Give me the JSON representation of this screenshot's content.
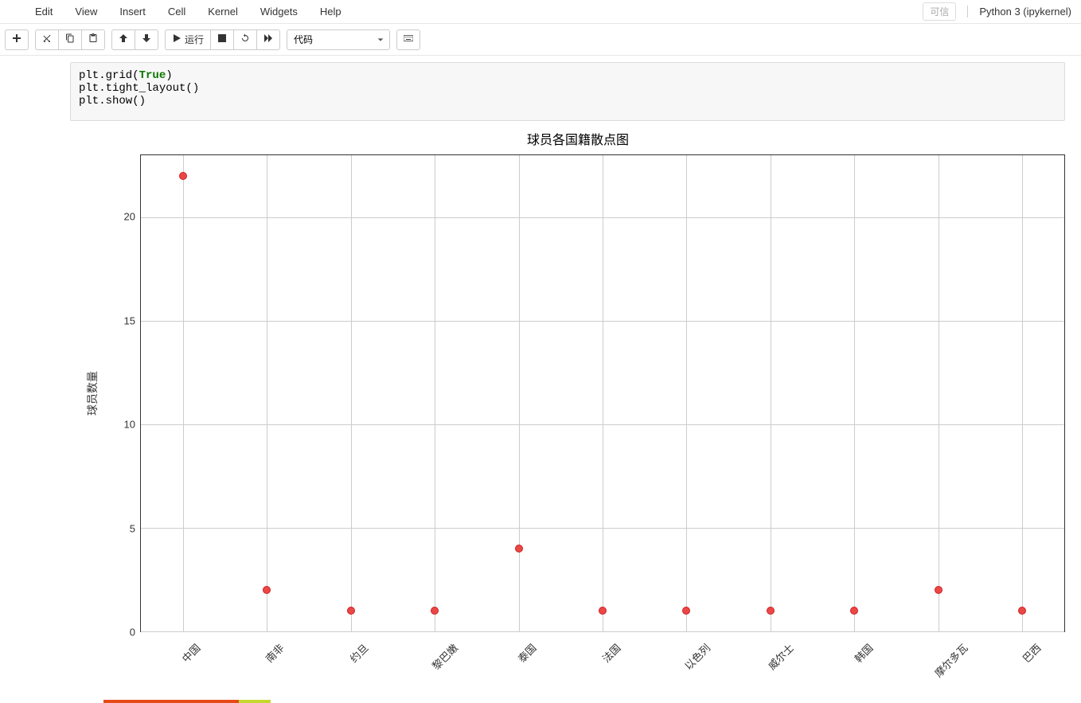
{
  "menu": {
    "edit": "Edit",
    "view": "View",
    "insert": "Insert",
    "cell": "Cell",
    "kernel": "Kernel",
    "widgets": "Widgets",
    "help": "Help"
  },
  "trusted_label": "可信",
  "kernel_name": "Python 3 (ipykernel)",
  "toolbar": {
    "run_label": "运行",
    "celltype_value": "代码"
  },
  "code_lines": {
    "l1_a": "plt.grid(",
    "l1_b": "True",
    "l1_c": ")",
    "l2": "plt.tight_layout()",
    "l3": "plt.show()"
  },
  "chart_data": {
    "type": "scatter",
    "title": "球员各国籍散点图",
    "xlabel": "",
    "ylabel": "球员数量",
    "ylim": [
      0,
      23
    ],
    "yticks": [
      0,
      5,
      10,
      15,
      20
    ],
    "categories": [
      "中国",
      "南非",
      "约旦",
      "黎巴嫩",
      "泰国",
      "法国",
      "以色列",
      "威尔士",
      "韩国",
      "摩尔多瓦",
      "巴西"
    ],
    "values": [
      22,
      2,
      1,
      1,
      4,
      1,
      1,
      1,
      1,
      2,
      1
    ],
    "marker_color": "#ec4747"
  }
}
